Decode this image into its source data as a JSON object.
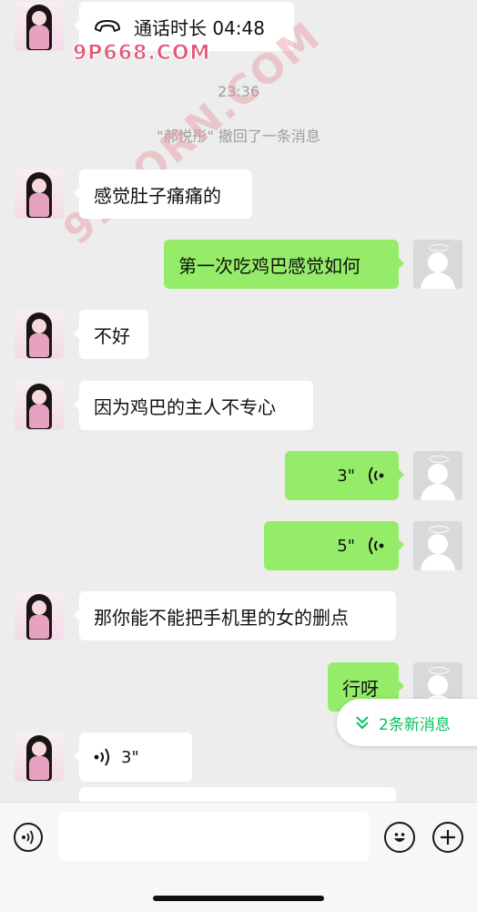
{
  "messages": {
    "call": {
      "text": "通话时长 04:48"
    },
    "time": "23:36",
    "recall_notice": "\"郝悦彤\" 撤回了一条消息",
    "m1": "感觉肚子痛痛的",
    "m2": "第一次吃鸡巴感觉如何",
    "m3": "不好",
    "m4": "因为鸡巴的主人不专心",
    "v1": "3\"",
    "v2": "5\"",
    "m5": "那你能不能把手机里的女的删点",
    "m6": "行呀",
    "v3": "3\""
  },
  "watermarks": {
    "top": "9P668.COM",
    "diagonal": "91PORN.COM"
  },
  "new_messages_pill": {
    "label": "2条新消息"
  },
  "colors": {
    "incoming_bubble": "#ffffff",
    "outgoing_bubble": "#95ec69",
    "accent_green": "#07c160",
    "background": "#ededed"
  },
  "icons": {
    "call": "phone-icon",
    "voice": "voice-wave-icon",
    "input_voice": "voice-mode-icon",
    "emoji": "emoji-icon",
    "plus": "plus-icon",
    "new_msg": "double-chevron-down-icon"
  }
}
